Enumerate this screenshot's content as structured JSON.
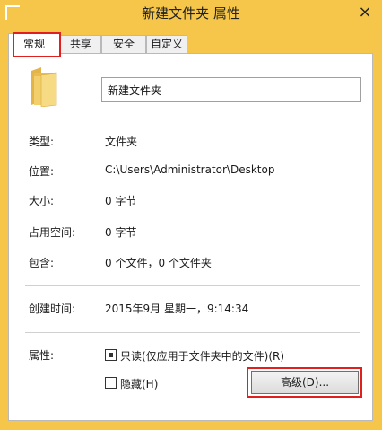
{
  "window": {
    "title": "新建文件夹 属性",
    "close_glyph": "×"
  },
  "tabs": [
    {
      "label": "常规",
      "active": true
    },
    {
      "label": "共享",
      "active": false
    },
    {
      "label": "安全",
      "active": false
    },
    {
      "label": "自定义",
      "active": false
    }
  ],
  "general": {
    "folder_name": "新建文件夹",
    "properties": [
      {
        "label": "类型:",
        "value": "文件夹"
      },
      {
        "label": "位置:",
        "value": "C:\\Users\\Administrator\\Desktop"
      },
      {
        "label": "大小:",
        "value": "0 字节"
      },
      {
        "label": "占用空间:",
        "value": "0 字节"
      },
      {
        "label": "包含:",
        "value": "0 个文件，0 个文件夹"
      },
      {
        "label": "创建时间:",
        "value": "2015年9月 星期一，9:14:34"
      }
    ],
    "attributes_label": "属性:",
    "readonly": {
      "label": "只读(仅应用于文件夹中的文件)(R)",
      "state": "indeterminate"
    },
    "hidden": {
      "label": "隐藏(H)",
      "checked": false
    },
    "advanced_button": "高级(D)..."
  },
  "colors": {
    "accent_frame": "#f5c64a",
    "highlight": "#e0201e",
    "folder": "#f0c75e"
  },
  "icons": {
    "folder": "folder-icon",
    "close": "close-icon"
  }
}
